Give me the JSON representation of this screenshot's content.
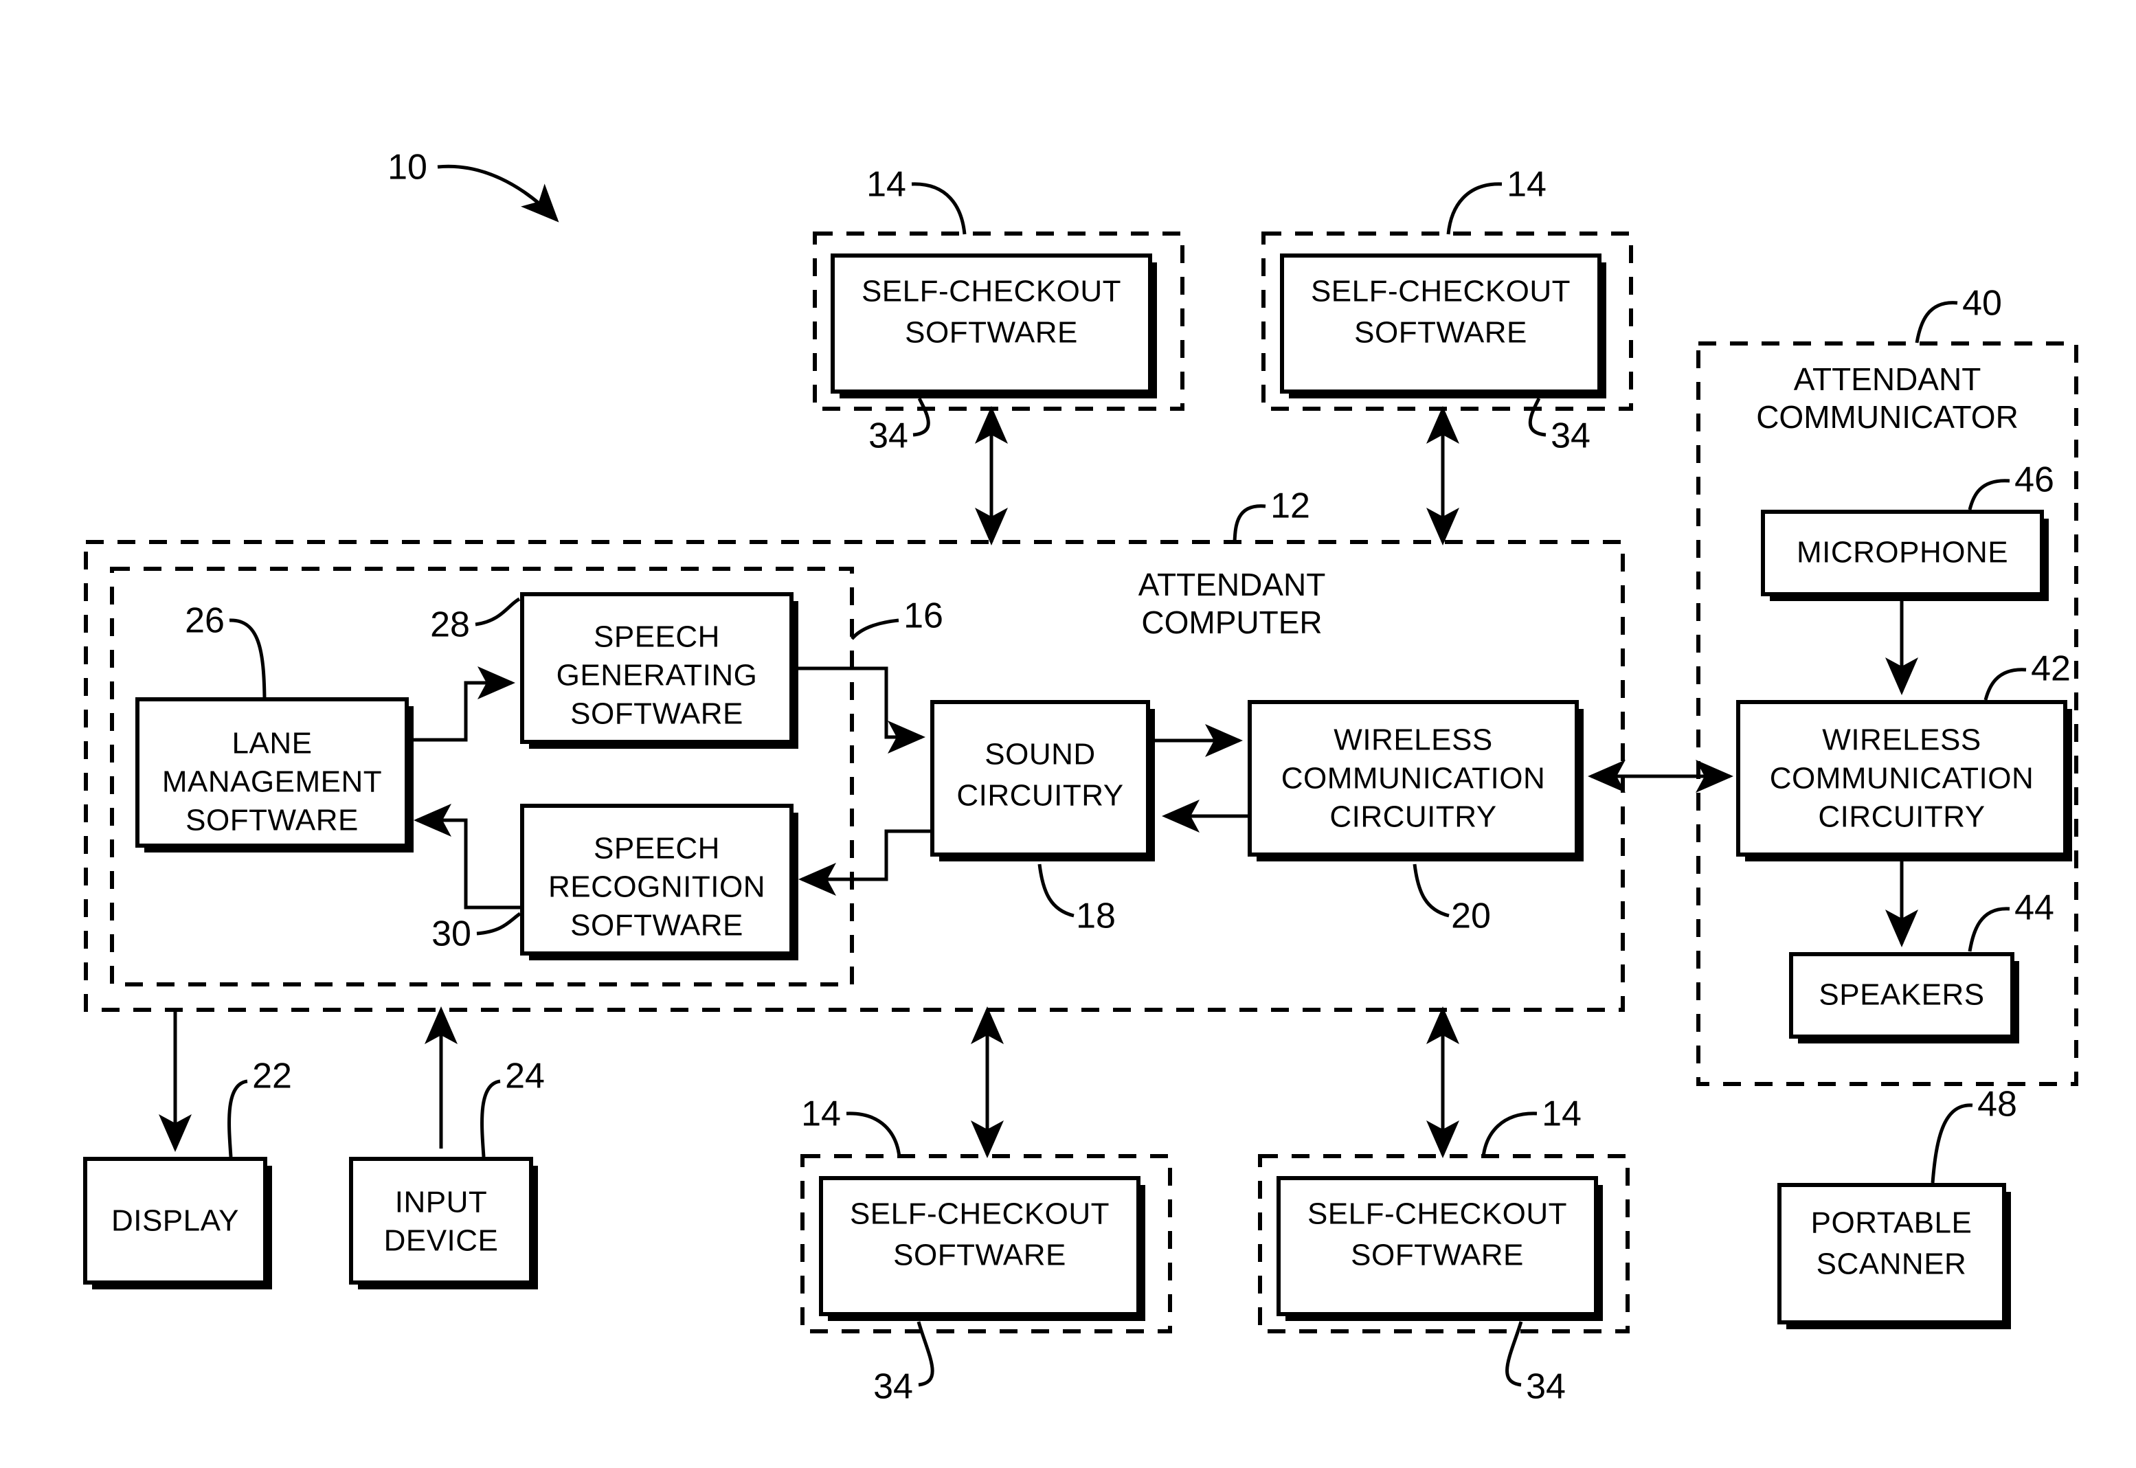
{
  "figure": {
    "system_ref": "10",
    "boxes": {
      "self_checkout_tl": {
        "label_line1": "SELF-CHECKOUT",
        "label_line2": "SOFTWARE",
        "outer_ref": "14",
        "inner_ref": "34"
      },
      "self_checkout_tr": {
        "label_line1": "SELF-CHECKOUT",
        "label_line2": "SOFTWARE",
        "outer_ref": "14",
        "inner_ref": "34"
      },
      "self_checkout_bl": {
        "label_line1": "SELF-CHECKOUT",
        "label_line2": "SOFTWARE",
        "outer_ref": "14",
        "inner_ref": "34"
      },
      "self_checkout_br": {
        "label_line1": "SELF-CHECKOUT",
        "label_line2": "SOFTWARE",
        "outer_ref": "14",
        "inner_ref": "34"
      },
      "attendant_computer": {
        "title_line1": "ATTENDANT",
        "title_line2": "COMPUTER",
        "ref": "12"
      },
      "software_group": {
        "ref": "16"
      },
      "lane_management": {
        "line1": "LANE",
        "line2": "MANAGEMENT",
        "line3": "SOFTWARE",
        "ref": "26"
      },
      "speech_generating": {
        "line1": "SPEECH",
        "line2": "GENERATING",
        "line3": "SOFTWARE",
        "ref": "28"
      },
      "speech_recognition": {
        "line1": "SPEECH",
        "line2": "RECOGNITION",
        "line3": "SOFTWARE",
        "ref": "30"
      },
      "sound_circuitry": {
        "line1": "SOUND",
        "line2": "CIRCUITRY",
        "ref": "18"
      },
      "wireless_comm_computer": {
        "line1": "WIRELESS",
        "line2": "COMMUNICATION",
        "line3": "CIRCUITRY",
        "ref": "20"
      },
      "display": {
        "line1": "DISPLAY",
        "ref": "22"
      },
      "input_device": {
        "line1": "INPUT",
        "line2": "DEVICE",
        "ref": "24"
      },
      "attendant_communicator": {
        "title_line1": "ATTENDANT",
        "title_line2": "COMMUNICATOR",
        "ref": "40"
      },
      "microphone": {
        "line1": "MICROPHONE",
        "ref": "46"
      },
      "wireless_comm_communicator": {
        "line1": "WIRELESS",
        "line2": "COMMUNICATION",
        "line3": "CIRCUITRY",
        "ref": "42"
      },
      "speakers": {
        "line1": "SPEAKERS",
        "ref": "44"
      },
      "portable_scanner": {
        "line1": "PORTABLE",
        "line2": "SCANNER",
        "ref": "48"
      }
    },
    "colors": {
      "ink": "#000000",
      "paper": "#ffffff"
    }
  }
}
